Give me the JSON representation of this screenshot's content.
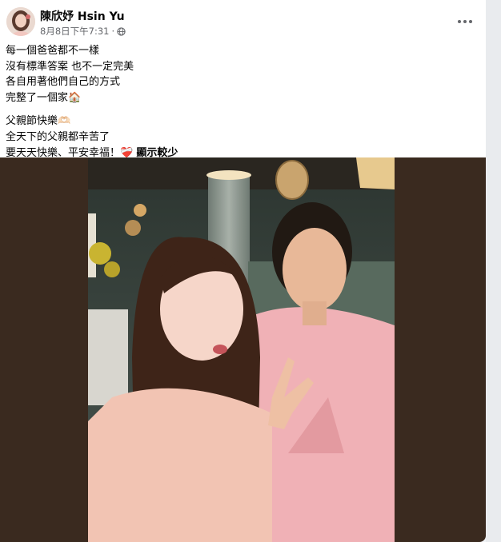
{
  "post": {
    "author": "陳欣妤 Hsin Yu",
    "timestamp": "8月8日下午7:31",
    "separator": "·",
    "privacy_icon": "globe-icon",
    "more_icon": "more-options-icon",
    "lines": [
      "每一個爸爸都不一樣",
      "沒有標準答案 也不一定完美",
      "各自用著他們自己的方式",
      "完整了一個家🏠"
    ],
    "lines2": [
      "父親節快樂🫶🏻",
      "全天下的父親都辛苦了",
      "要天天快樂、平安幸福！❤️‍🩹"
    ],
    "see_less": "顯示較少"
  },
  "colors": {
    "text": "#050505",
    "meta": "#65676b",
    "media_bg": "#3a2a1f"
  }
}
